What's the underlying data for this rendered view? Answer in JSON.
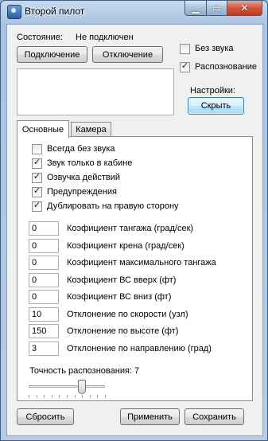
{
  "window": {
    "title": "Второй пилот",
    "buttons": {
      "minimize": "▁",
      "maximize": "▭",
      "close": "✕"
    }
  },
  "status": {
    "label": "Состояние:",
    "value": "Не подключен"
  },
  "actions": {
    "connect": "Подключение",
    "disconnect": "Отключение"
  },
  "options": {
    "mute": {
      "label": "Без звука",
      "checked": false
    },
    "recognition": {
      "label": "Распознование",
      "checked": true
    }
  },
  "settings": {
    "label": "Настройки:",
    "hide_button": "Скрыть"
  },
  "tabs": [
    {
      "label": "Основные",
      "active": true
    },
    {
      "label": "Камера",
      "active": false
    }
  ],
  "checkboxes": [
    {
      "label": "Всегда без звука",
      "checked": false
    },
    {
      "label": "Звук только в кабине",
      "checked": true
    },
    {
      "label": "Озвучка действий",
      "checked": true
    },
    {
      "label": "Предупреждения",
      "checked": true
    },
    {
      "label": "Дублировать на правую сторону",
      "checked": true
    }
  ],
  "fields": [
    {
      "value": "0",
      "label": "Коэфициент тангажа (град/сек)"
    },
    {
      "value": "0",
      "label": "Коэфициент крена (град/сек)"
    },
    {
      "value": "0",
      "label": "Коэфициент максимального тангажа"
    },
    {
      "value": "0",
      "label": "Коэфициент ВС вверх (фт)"
    },
    {
      "value": "0",
      "label": "Коэфициент ВС вниз (фт)"
    },
    {
      "value": "10",
      "label": "Отклонение по скорости (узл)"
    },
    {
      "value": "150",
      "label": "Отклонение по высоте (фт)"
    },
    {
      "value": "3",
      "label": "Отклонение по направлению (град)"
    }
  ],
  "accuracy": {
    "label": "Точность распознования: 7",
    "value": 7,
    "min": 0,
    "max": 10
  },
  "footer": {
    "reset": "Сбросить",
    "apply": "Применить",
    "save": "Сохранить"
  }
}
